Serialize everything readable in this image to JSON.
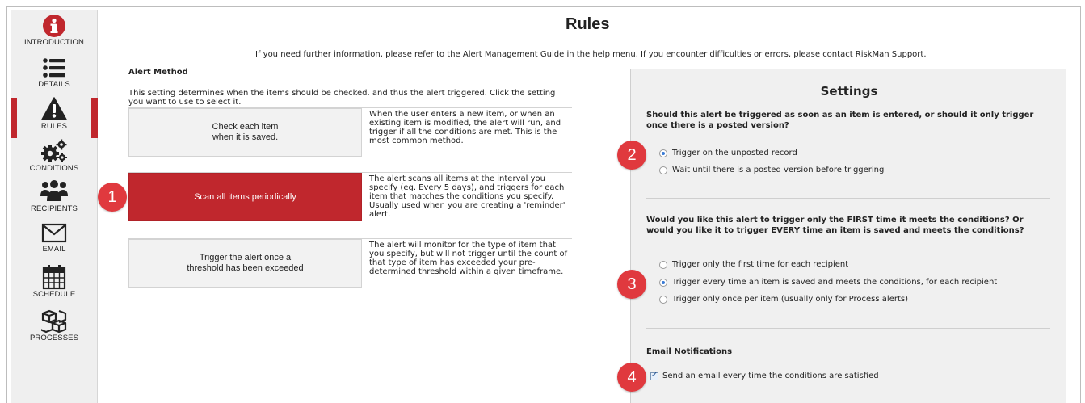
{
  "page": {
    "title": "Rules",
    "info": "If you need further information, please refer to the Alert Management Guide in the help menu. If you encounter difficulties or errors, please contact RiskMan Support."
  },
  "sidebar": {
    "items": [
      {
        "label": "INTRODUCTION",
        "icon": "info-icon"
      },
      {
        "label": "DETAILS",
        "icon": "list-icon"
      },
      {
        "label": "RULES",
        "icon": "warning-icon",
        "active": true
      },
      {
        "label": "CONDITIONS",
        "icon": "gears-icon"
      },
      {
        "label": "RECIPIENTS",
        "icon": "people-icon"
      },
      {
        "label": "EMAIL",
        "icon": "envelope-icon"
      },
      {
        "label": "SCHEDULE",
        "icon": "calendar-icon"
      },
      {
        "label": "PROCESSES",
        "icon": "cubes-icon"
      }
    ],
    "accent": "#c0272d"
  },
  "alert_method": {
    "heading": "Alert Method",
    "description": "This setting determines when the items should be checked. and thus the alert triggered. Click the setting you want to use to select it.",
    "options": [
      {
        "label_line1": "Check each item",
        "label_line2": "when it is saved.",
        "description": "When the user enters a new item, or when an existing item is modified, the alert will run, and trigger if all the conditions are met. This is the most common method.",
        "selected": false
      },
      {
        "label_line1": "Scan all items periodically",
        "label_line2": "",
        "description": "The alert scans all items at the interval you specify (eg. Every 5 days), and triggers for each item that matches the conditions you specify. Usually used when you are creating a 'reminder' alert.",
        "selected": true
      },
      {
        "label_line1": "Trigger the alert once a",
        "label_line2": "threshold has been exceeded",
        "description": "The alert will monitor for the type of item that you specify, but will not trigger until the count of that type of item has exceeded your pre-determined threshold within a given timeframe.",
        "selected": false
      }
    ]
  },
  "callouts": [
    "1",
    "2",
    "3",
    "4"
  ],
  "settings": {
    "title": "Settings",
    "q1": "Should this alert be triggered as soon as an item is entered, or should it only trigger once there is a posted version?",
    "q1_options": [
      "Trigger on the unposted record",
      "Wait until there is a posted version before triggering"
    ],
    "q1_selected": 0,
    "q2": "Would you like this alert to trigger only the FIRST time it meets the conditions? Or would you like it to trigger EVERY time an item is saved and meets the conditions?",
    "q2_options": [
      "Trigger only the first time for each recipient",
      "Trigger every time an item is saved and meets the conditions, for each recipient",
      "Trigger only once per item (usually only for Process alerts)"
    ],
    "q2_selected": 1,
    "email_heading": "Email Notifications",
    "email_checkbox": "Send an email every time the conditions are satisfied",
    "email_checked": true
  }
}
